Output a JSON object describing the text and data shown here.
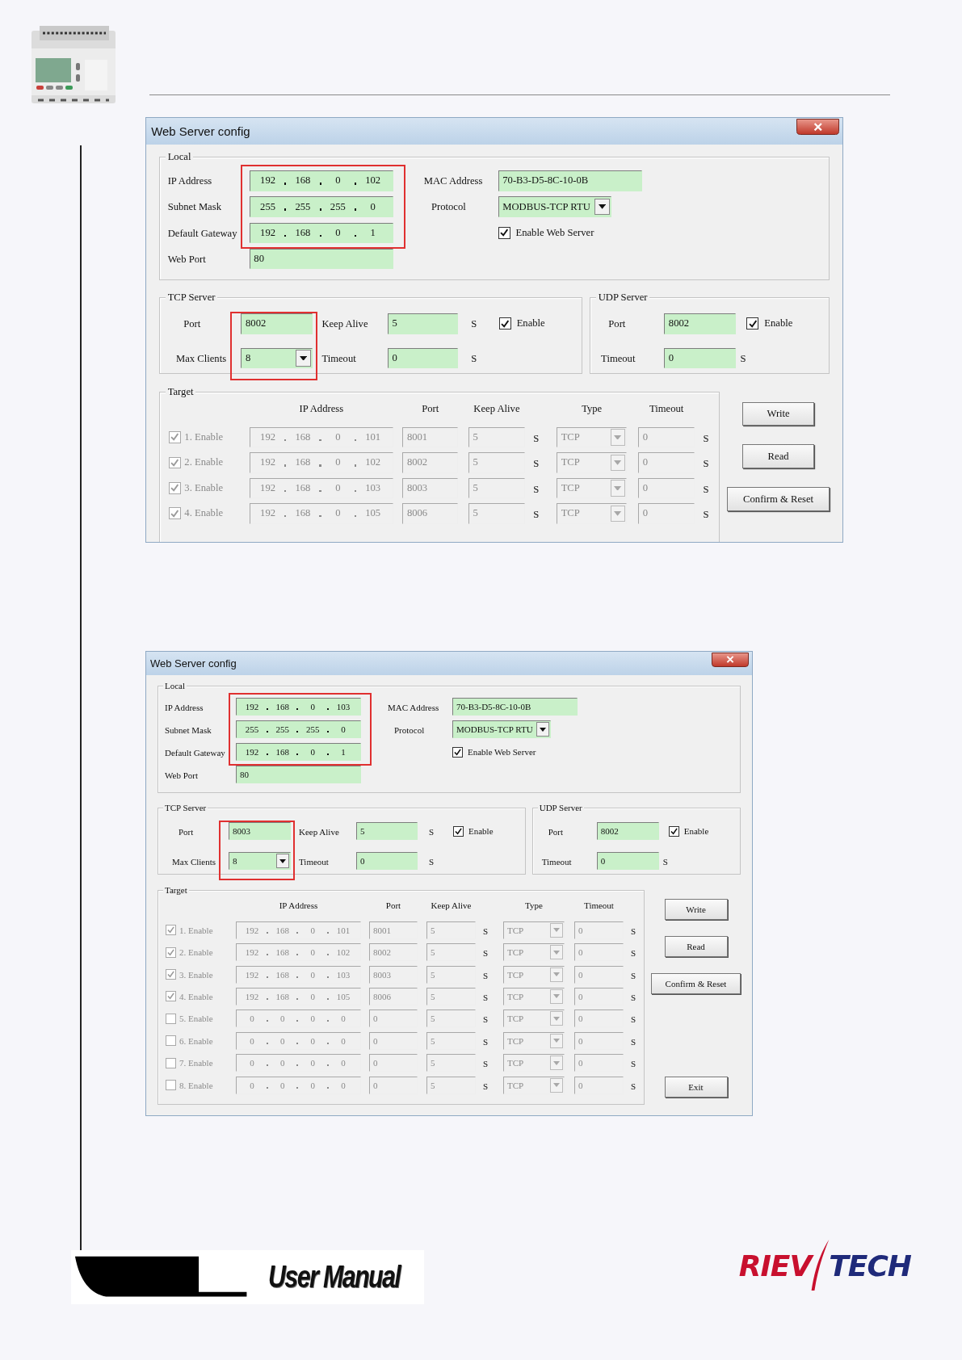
{
  "dialogs": [
    {
      "title": "Web Server config",
      "local": {
        "legend": "Local",
        "ip_highlighted": true,
        "rows": [
          {
            "label": "IP Address",
            "octets": [
              "192",
              "168",
              "0",
              "102"
            ]
          },
          {
            "label": "Subnet Mask",
            "octets": [
              "255",
              "255",
              "255",
              "0"
            ]
          },
          {
            "label": "Default Gateway",
            "octets": [
              "192",
              "168",
              "0",
              "1"
            ]
          }
        ],
        "web_port": {
          "label": "Web Port",
          "value": "80"
        },
        "mac": {
          "label": "MAC Address",
          "value": "70-B3-D5-8C-10-0B"
        },
        "protocol": {
          "label": "Protocol",
          "value": "MODBUS-TCP RTU"
        },
        "enable_web_server": {
          "label": "Enable Web Server",
          "checked": true
        }
      },
      "tcp_server": {
        "legend": "TCP Server",
        "highlighted": true,
        "port_label": "Port",
        "port": "8002",
        "max_clients_label": "Max Clients",
        "max_clients": "8",
        "keep_alive_label": "Keep Alive",
        "keep_alive": "5",
        "keep_alive_unit": "S",
        "timeout_label": "Timeout",
        "timeout": "0",
        "timeout_unit": "S",
        "enable": {
          "label": "Enable",
          "checked": true
        }
      },
      "udp_server": {
        "legend": "UDP Server",
        "port_label": "Port",
        "port": "8002",
        "timeout_label": "Timeout",
        "timeout": "0",
        "timeout_unit": "S",
        "enable": {
          "label": "Enable",
          "checked": true
        }
      },
      "target": {
        "legend": "Target",
        "columns": [
          "IP Address",
          "Port",
          "Keep Alive",
          "Type",
          "Timeout"
        ],
        "rows": [
          {
            "label": "1. Enable",
            "checked": true,
            "octets": [
              "192",
              "168",
              "0",
              "101"
            ],
            "port": "8001",
            "keep_alive": "5",
            "keep_alive_unit": "S",
            "type": "TCP",
            "timeout": "0",
            "timeout_unit": "S"
          },
          {
            "label": "2. Enable",
            "checked": true,
            "octets": [
              "192",
              "168",
              "0",
              "102"
            ],
            "port": "8002",
            "keep_alive": "5",
            "keep_alive_unit": "S",
            "type": "TCP",
            "timeout": "0",
            "timeout_unit": "S"
          },
          {
            "label": "3. Enable",
            "checked": true,
            "octets": [
              "192",
              "168",
              "0",
              "103"
            ],
            "port": "8003",
            "keep_alive": "5",
            "keep_alive_unit": "S",
            "type": "TCP",
            "timeout": "0",
            "timeout_unit": "S"
          },
          {
            "label": "4. Enable",
            "checked": true,
            "octets": [
              "192",
              "168",
              "0",
              "105"
            ],
            "port": "8006",
            "keep_alive": "5",
            "keep_alive_unit": "S",
            "type": "TCP",
            "timeout": "0",
            "timeout_unit": "S"
          }
        ]
      },
      "buttons": [
        {
          "label": "Write",
          "kind": "action"
        },
        {
          "label": "Read",
          "kind": "action"
        },
        {
          "label": "Confirm & Reset",
          "kind": "action"
        }
      ]
    },
    {
      "title": "Web Server config",
      "local": {
        "legend": "Local",
        "ip_highlighted": true,
        "rows": [
          {
            "label": "IP Address",
            "octets": [
              "192",
              "168",
              "0",
              "103"
            ]
          },
          {
            "label": "Subnet Mask",
            "octets": [
              "255",
              "255",
              "255",
              "0"
            ]
          },
          {
            "label": "Default Gateway",
            "octets": [
              "192",
              "168",
              "0",
              "1"
            ]
          }
        ],
        "web_port": {
          "label": "Web Port",
          "value": "80"
        },
        "mac": {
          "label": "MAC Address",
          "value": "70-B3-D5-8C-10-0B"
        },
        "protocol": {
          "label": "Protocol",
          "value": "MODBUS-TCP RTU"
        },
        "enable_web_server": {
          "label": "Enable Web Server",
          "checked": true
        }
      },
      "tcp_server": {
        "legend": "TCP Server",
        "highlighted": true,
        "port_label": "Port",
        "port": "8003",
        "max_clients_label": "Max Clients",
        "max_clients": "8",
        "keep_alive_label": "Keep Alive",
        "keep_alive": "5",
        "keep_alive_unit": "S",
        "timeout_label": "Timeout",
        "timeout": "0",
        "timeout_unit": "S",
        "enable": {
          "label": "Enable",
          "checked": true
        }
      },
      "udp_server": {
        "legend": "UDP Server",
        "port_label": "Port",
        "port": "8002",
        "timeout_label": "Timeout",
        "timeout": "0",
        "timeout_unit": "S",
        "enable": {
          "label": "Enable",
          "checked": true
        }
      },
      "target": {
        "legend": "Target",
        "columns": [
          "IP Address",
          "Port",
          "Keep Alive",
          "Type",
          "Timeout"
        ],
        "rows": [
          {
            "label": "1. Enable",
            "checked": true,
            "octets": [
              "192",
              "168",
              "0",
              "101"
            ],
            "port": "8001",
            "keep_alive": "5",
            "keep_alive_unit": "S",
            "type": "TCP",
            "timeout": "0",
            "timeout_unit": "S"
          },
          {
            "label": "2. Enable",
            "checked": true,
            "octets": [
              "192",
              "168",
              "0",
              "102"
            ],
            "port": "8002",
            "keep_alive": "5",
            "keep_alive_unit": "S",
            "type": "TCP",
            "timeout": "0",
            "timeout_unit": "S"
          },
          {
            "label": "3. Enable",
            "checked": true,
            "octets": [
              "192",
              "168",
              "0",
              "103"
            ],
            "port": "8003",
            "keep_alive": "5",
            "keep_alive_unit": "S",
            "type": "TCP",
            "timeout": "0",
            "timeout_unit": "S"
          },
          {
            "label": "4. Enable",
            "checked": true,
            "octets": [
              "192",
              "168",
              "0",
              "105"
            ],
            "port": "8006",
            "keep_alive": "5",
            "keep_alive_unit": "S",
            "type": "TCP",
            "timeout": "0",
            "timeout_unit": "S"
          },
          {
            "label": "5. Enable",
            "checked": false,
            "octets": [
              "0",
              "0",
              "0",
              "0"
            ],
            "port": "0",
            "keep_alive": "5",
            "keep_alive_unit": "S",
            "type": "TCP",
            "timeout": "0",
            "timeout_unit": "S"
          },
          {
            "label": "6. Enable",
            "checked": false,
            "octets": [
              "0",
              "0",
              "0",
              "0"
            ],
            "port": "0",
            "keep_alive": "5",
            "keep_alive_unit": "S",
            "type": "TCP",
            "timeout": "0",
            "timeout_unit": "S"
          },
          {
            "label": "7. Enable",
            "checked": false,
            "octets": [
              "0",
              "0",
              "0",
              "0"
            ],
            "port": "0",
            "keep_alive": "5",
            "keep_alive_unit": "S",
            "type": "TCP",
            "timeout": "0",
            "timeout_unit": "S"
          },
          {
            "label": "8. Enable",
            "checked": false,
            "octets": [
              "0",
              "0",
              "0",
              "0"
            ],
            "port": "0",
            "keep_alive": "5",
            "keep_alive_unit": "S",
            "type": "TCP",
            "timeout": "0",
            "timeout_unit": "S"
          }
        ]
      },
      "buttons": [
        {
          "label": "Write",
          "kind": "action"
        },
        {
          "label": "Read",
          "kind": "action"
        },
        {
          "label": "Confirm & Reset",
          "kind": "action"
        },
        {
          "label": "Exit",
          "kind": "exit"
        }
      ]
    }
  ],
  "footer": {
    "title": "User Manual",
    "brand": [
      "RIEV",
      "TECH"
    ]
  }
}
